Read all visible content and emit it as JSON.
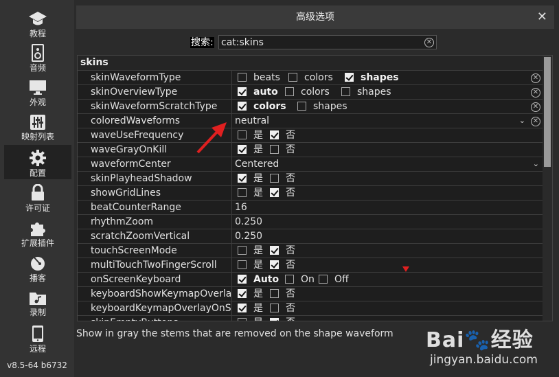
{
  "window": {
    "title": "高级选项",
    "close_glyph": "✕"
  },
  "sidebar": {
    "items": [
      {
        "label": "教程",
        "icon": "graduation-cap-icon"
      },
      {
        "label": "音频",
        "icon": "speaker-icon"
      },
      {
        "label": "外观",
        "icon": "monitor-icon"
      },
      {
        "label": "映射列表",
        "icon": "mixer-sliders-icon"
      },
      {
        "label": "配置",
        "icon": "gear-icon",
        "active": true
      },
      {
        "label": "许可证",
        "icon": "lock-icon"
      },
      {
        "label": "扩展插件",
        "icon": "puzzle-icon"
      },
      {
        "label": "播客",
        "icon": "podcast-icon"
      },
      {
        "label": "录制",
        "icon": "music-folder-icon"
      },
      {
        "label": "远程",
        "icon": "phone-icon"
      }
    ],
    "version": "v8.5-64 b6732"
  },
  "search": {
    "label": "搜索:",
    "value": "cat:skins"
  },
  "table": {
    "group": "skins",
    "rows": [
      {
        "name": "skinWaveformType",
        "opts": [
          {
            "t": "beats",
            "on": false
          },
          {
            "t": "colors",
            "on": false
          },
          {
            "t": "shapes",
            "on": true,
            "b": true
          }
        ],
        "clear": true
      },
      {
        "name": "skinOverviewType",
        "opts": [
          {
            "t": "auto",
            "on": true,
            "b": true
          },
          {
            "t": "colors",
            "on": false
          },
          {
            "t": "shapes",
            "on": false
          }
        ],
        "clear": true
      },
      {
        "name": "skinWaveformScratchType",
        "opts": [
          {
            "t": "colors",
            "on": true,
            "b": true
          },
          {
            "t": "shapes",
            "on": false
          }
        ],
        "clear": true
      },
      {
        "name": "coloredWaveforms",
        "text": "neutral",
        "dropdown": true,
        "clear": true
      },
      {
        "name": "waveUseFrequency",
        "opts": [
          {
            "t": "是",
            "on": false
          },
          {
            "t": "否",
            "on": true
          }
        ]
      },
      {
        "name": "waveGrayOnKill",
        "opts": [
          {
            "t": "是",
            "on": true
          },
          {
            "t": "否",
            "on": false
          }
        ]
      },
      {
        "name": "waveformCenter",
        "text": "Centered",
        "dropdown": true
      },
      {
        "name": "skinPlayheadShadow",
        "opts": [
          {
            "t": "是",
            "on": true
          },
          {
            "t": "否",
            "on": false
          }
        ]
      },
      {
        "name": "showGridLines",
        "opts": [
          {
            "t": "是",
            "on": false
          },
          {
            "t": "否",
            "on": true
          }
        ]
      },
      {
        "name": "beatCounterRange",
        "text": "16"
      },
      {
        "name": "rhythmZoom",
        "text": "0.250"
      },
      {
        "name": "scratchZoomVertical",
        "text": "0.250"
      },
      {
        "name": "touchScreenMode",
        "opts": [
          {
            "t": "是",
            "on": false
          },
          {
            "t": "否",
            "on": true
          }
        ]
      },
      {
        "name": "multiTouchTwoFingerScroll",
        "opts": [
          {
            "t": "是",
            "on": false
          },
          {
            "t": "否",
            "on": true
          }
        ]
      },
      {
        "name": "onScreenKeyboard",
        "opts": [
          {
            "t": "Auto",
            "on": true,
            "b": true
          },
          {
            "t": "On",
            "on": false
          },
          {
            "t": "Off",
            "on": false
          }
        ]
      },
      {
        "name": "keyboardShowKeymapOverlay",
        "opts": [
          {
            "t": "是",
            "on": true
          },
          {
            "t": "否",
            "on": false
          }
        ]
      },
      {
        "name": "keyboardKeymapOverlayOnStic",
        "opts": [
          {
            "t": "是",
            "on": true
          },
          {
            "t": "否",
            "on": false
          }
        ]
      },
      {
        "name": "skinEmptyButtons",
        "opts": [
          {
            "t": "是",
            "on": false
          },
          {
            "t": "否",
            "on": true
          }
        ]
      }
    ]
  },
  "description": "Show in gray the stems that are removed on the shape waveform",
  "watermark": {
    "logo": "Bai🐾经验",
    "url": "jingyan.baidu.com"
  },
  "colors": {
    "background": "#2b2b2b",
    "table_bg": "#1e1e1e",
    "annotation_red": "#e02020"
  }
}
